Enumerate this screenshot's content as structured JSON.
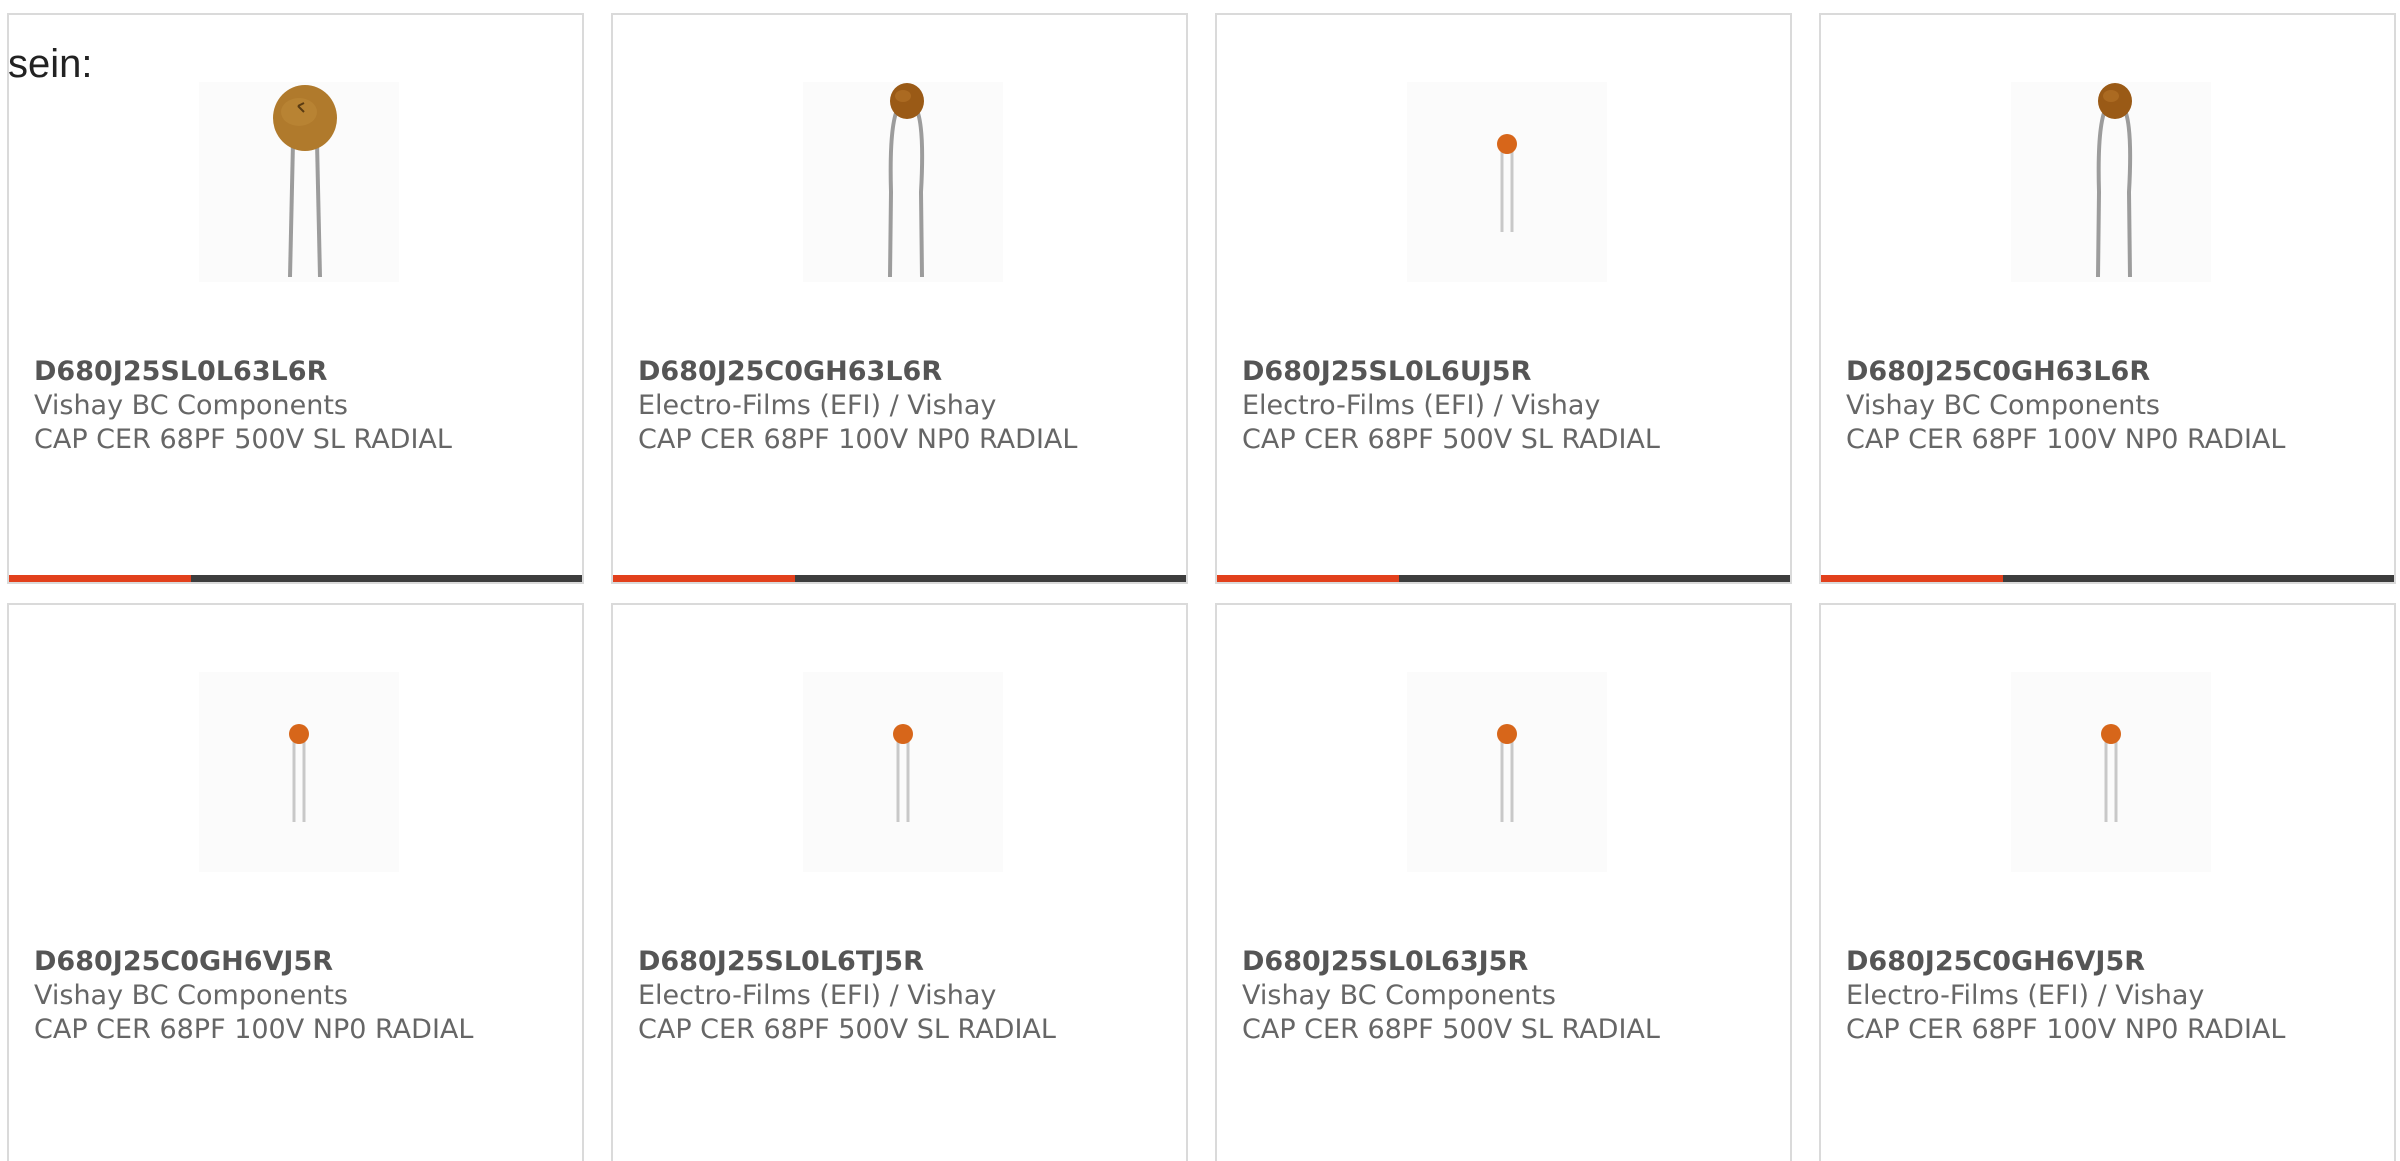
{
  "intro_text": "sein:",
  "colors": {
    "accent": "#e2401c",
    "bar_track": "#3d3d3d",
    "card_border": "#dadada",
    "capacitor_large": "#b07a2c",
    "capacitor_small": "#d7661a",
    "lead": "#a8a8a8"
  },
  "products": [
    {
      "part_number": "D680J25SL0L63L6R",
      "manufacturer": "Vishay BC Components",
      "description": "CAP CER 68PF 500V SL RADIAL",
      "image_icon": "ceramic-disc-capacitor-large-icon"
    },
    {
      "part_number": "D680J25C0GH63L6R",
      "manufacturer": "Electro-Films (EFI) / Vishay",
      "description": "CAP CER 68PF 100V NP0 RADIAL",
      "image_icon": "ceramic-disc-capacitor-long-leads-icon"
    },
    {
      "part_number": "D680J25SL0L6UJ5R",
      "manufacturer": "Electro-Films (EFI) / Vishay",
      "description": "CAP CER 68PF 500V SL RADIAL",
      "image_icon": "ceramic-disc-capacitor-small-icon"
    },
    {
      "part_number": "D680J25C0GH63L6R",
      "manufacturer": "Vishay BC Components",
      "description": "CAP CER 68PF 100V NP0 RADIAL",
      "image_icon": "ceramic-disc-capacitor-long-leads-icon"
    },
    {
      "part_number": "D680J25C0GH6VJ5R",
      "manufacturer": "Vishay BC Components",
      "description": "CAP CER 68PF 100V NP0 RADIAL",
      "image_icon": "ceramic-disc-capacitor-small-icon"
    },
    {
      "part_number": "D680J25SL0L6TJ5R",
      "manufacturer": "Electro-Films (EFI) / Vishay",
      "description": "CAP CER 68PF 500V SL RADIAL",
      "image_icon": "ceramic-disc-capacitor-small-icon"
    },
    {
      "part_number": "D680J25SL0L63J5R",
      "manufacturer": "Vishay BC Components",
      "description": "CAP CER 68PF 500V SL RADIAL",
      "image_icon": "ceramic-disc-capacitor-small-icon"
    },
    {
      "part_number": "D680J25C0GH6VJ5R",
      "manufacturer": "Electro-Films (EFI) / Vishay",
      "description": "CAP CER 68PF 100V NP0 RADIAL",
      "image_icon": "ceramic-disc-capacitor-small-icon"
    }
  ]
}
